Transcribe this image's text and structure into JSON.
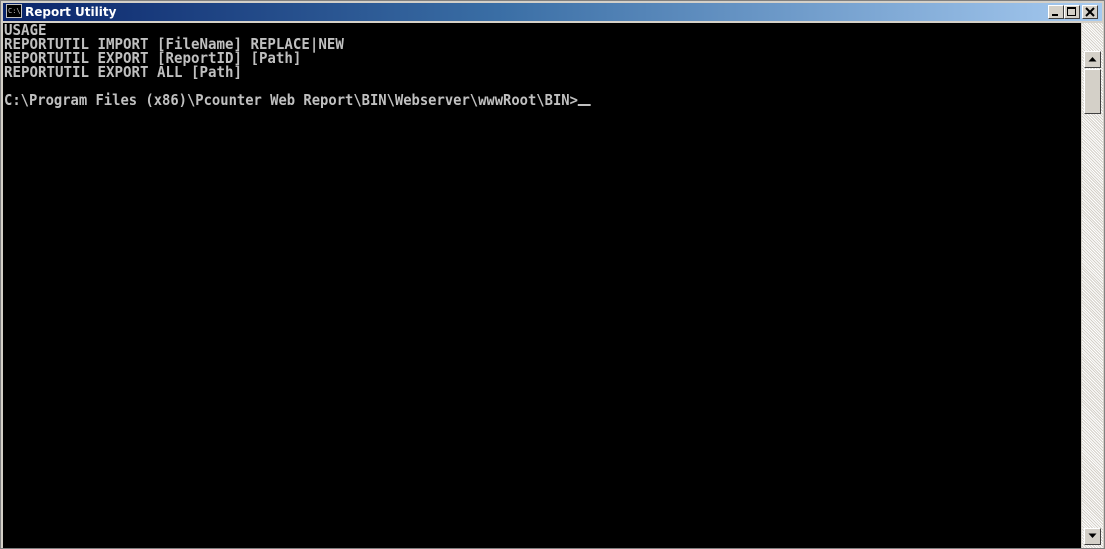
{
  "window": {
    "title": "Report Utility",
    "icon_label": "C:\\",
    "controls": {
      "minimize": "minimize-icon",
      "maximize": "maximize-icon",
      "close": "close-icon"
    }
  },
  "console": {
    "lines": [
      "USAGE",
      "REPORTUTIL IMPORT [FileName] REPLACE|NEW",
      "REPORTUTIL EXPORT [ReportID] [Path]",
      "REPORTUTIL EXPORT ALL [Path]",
      "",
      "C:\\Program Files (x86)\\Pcounter Web Report\\BIN\\Webserver\\wwwRoot\\BIN>"
    ],
    "text_color": "#c0c0c0",
    "background_color": "#000000"
  },
  "scrollbar": {
    "up_icon": "arrow-up-icon",
    "down_icon": "arrow-down-icon"
  }
}
